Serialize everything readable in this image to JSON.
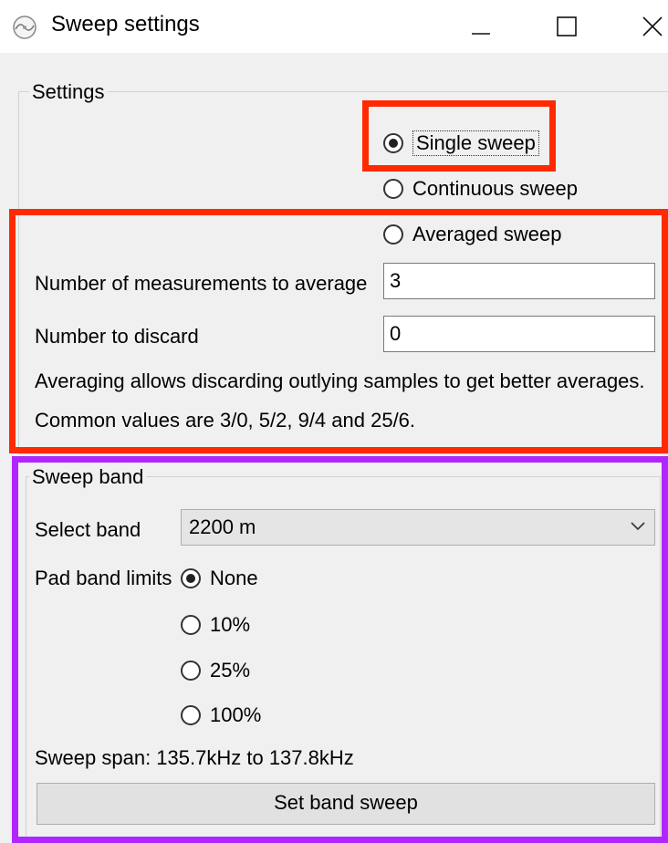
{
  "window": {
    "title": "Sweep settings",
    "icons": {
      "app": "app-logo-icon",
      "minimize": "minimize-icon",
      "maximize": "maximize-icon",
      "close": "close-icon"
    }
  },
  "settings": {
    "legend": "Settings",
    "sweep_mode": {
      "options": [
        "Single sweep",
        "Continuous sweep",
        "Averaged sweep"
      ],
      "selected": "Single sweep"
    },
    "measurements_label": "Number of measurements to average",
    "measurements_value": "3",
    "discard_label": "Number to discard",
    "discard_value": "0",
    "info_line1": "Averaging allows discarding outlying samples to get better averages.",
    "info_line2": "Common values are 3/0, 5/2, 9/4 and 25/6."
  },
  "sweep_band": {
    "legend": "Sweep band",
    "select_label": "Select band",
    "selected_band": "2200 m",
    "pad_label": "Pad band limits",
    "pad_options": [
      "None",
      "10%",
      "25%",
      "100%"
    ],
    "pad_selected": "None",
    "span_text": "Sweep span: 135.7kHz to 137.8kHz",
    "set_button": "Set band sweep"
  },
  "annotations": {
    "red": "#ff2a00",
    "purple": "#b026ff"
  }
}
